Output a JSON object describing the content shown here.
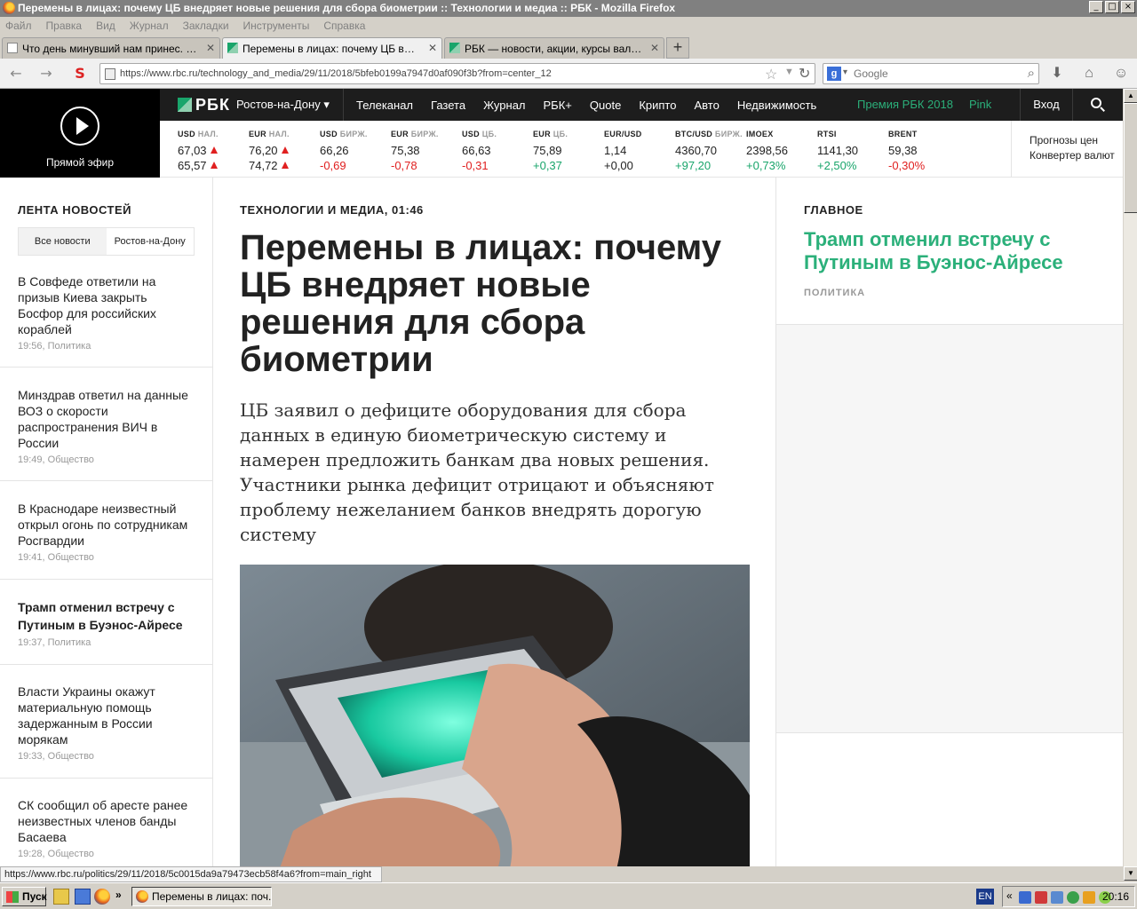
{
  "window": {
    "title": "Перемены в лицах: почему ЦБ внедряет новые решения для сбора биометрии :: Технологии и медиа :: РБК - Mozilla Firefox",
    "controls": [
      "_",
      "□",
      "×"
    ]
  },
  "menu": [
    "Файл",
    "Правка",
    "Вид",
    "Журнал",
    "Закладки",
    "Инструменты",
    "Справка"
  ],
  "tabs": [
    {
      "label": "Что день минувший нам принес. Аргум..."
    },
    {
      "label": "Перемены в лицах: почему ЦБ внедря..."
    },
    {
      "label": "РБК — новости, акции, курсы валют, ..."
    }
  ],
  "nav": {
    "url": "https://www.rbc.ru/technology_and_media/29/11/2018/5bfeb0199a7947d0af090f3b?from=center_12",
    "search_placeholder": "Google"
  },
  "site": {
    "live_label": "Прямой эфир",
    "logo": "РБК",
    "city": "Ростов-на-Дону ▾",
    "nav": [
      "Телеканал",
      "Газета",
      "Журнал",
      "РБК+",
      "Quote",
      "Крипто",
      "Авто",
      "Недвижимость"
    ],
    "premium": "Премия РБК 2018",
    "pink": "Pink",
    "login": "Вход"
  },
  "tickers": [
    {
      "label": "USD",
      "sub": "НАЛ.",
      "v1": "67,03",
      "v2": "65,57",
      "arrows": true
    },
    {
      "label": "EUR",
      "sub": "НАЛ.",
      "v1": "76,20",
      "v2": "74,72",
      "arrows": true
    },
    {
      "label": "USD",
      "sub": "БИРЖ.",
      "v1": "66,26",
      "v2": "-0,69",
      "c2": "down"
    },
    {
      "label": "EUR",
      "sub": "БИРЖ.",
      "v1": "75,38",
      "v2": "-0,78",
      "c2": "down"
    },
    {
      "label": "USD",
      "sub": "ЦБ.",
      "v1": "66,63",
      "v2": "-0,31",
      "c2": "down"
    },
    {
      "label": "EUR",
      "sub": "ЦБ.",
      "v1": "75,89",
      "v2": "+0,37",
      "c2": "up"
    },
    {
      "label": "EUR/USD",
      "sub": "",
      "v1": "1,14",
      "v2": "+0,00",
      "c2": "neutral"
    },
    {
      "label": "BTC/USD",
      "sub": "БИРЖ.",
      "v1": "4360,70",
      "v2": "+97,20",
      "c2": "up"
    },
    {
      "label": "IMOEX",
      "sub": "",
      "v1": "2398,56",
      "v2": "+0,73%",
      "c2": "up"
    },
    {
      "label": "RTSI",
      "sub": "",
      "v1": "1141,30",
      "v2": "+2,50%",
      "c2": "up"
    },
    {
      "label": "BRENT",
      "sub": "",
      "v1": "59,38",
      "v2": "-0,30%",
      "c2": "down"
    }
  ],
  "ticker_links": [
    "Прогнозы цен",
    "Конвертер валют"
  ],
  "feed": {
    "heading": "ЛЕНТА НОВОСТЕЙ",
    "tabs": [
      "Все новости",
      "Ростов-на-Дону"
    ],
    "items": [
      {
        "title": "В Совфеде ответили на призыв Киева закрыть Босфор для российских кораблей",
        "meta": "19:56, Политика"
      },
      {
        "title": "Минздрав ответил на данные ВОЗ о скорости распространения ВИЧ в России",
        "meta": "19:49, Общество"
      },
      {
        "title": "В Краснодаре неизвестный открыл огонь по сотрудникам Росгвардии",
        "meta": "19:41, Общество"
      },
      {
        "title": "Трамп отменил встречу с Путиным в Буэнос-Айресе",
        "meta": "19:37, Политика",
        "bold": true
      },
      {
        "title": "Власти Украины окажут материальную помощь задержанным в России морякам",
        "meta": "19:33, Общество"
      },
      {
        "title": "СК сообщил об аресте ранее неизвестных членов банды Басаева",
        "meta": "19:28, Общество"
      }
    ]
  },
  "article": {
    "category": "ТЕХНОЛОГИИ И МЕДИА, 01:46",
    "title": "Перемены в лицах: почему ЦБ внедряет новые решения для сбора биометрии",
    "lead": "ЦБ заявил о дефиците оборудования для сбора данных в единую биометрическую систему и намерен предложить банкам два новых решения. Участники рынка дефицит отрицают и объясняют проблему нежеланием банков внедрять дорогую систему"
  },
  "main": {
    "heading": "ГЛАВНОЕ",
    "title": "Трамп отменил встречу с Путиным в Буэнос-Айресе",
    "category": "ПОЛИТИКА"
  },
  "status_url": "https://www.rbc.ru/politics/29/11/2018/5c0015da9a79473ecb58f4a6?from=main_right",
  "taskbar": {
    "start": "Пуск",
    "task": "Перемены в лицах: поч...",
    "lang": "EN",
    "clock": "20:16"
  },
  "colors": {
    "accent": "#2bb07a",
    "up": "#19a56b",
    "down": "#e02020",
    "header": "#1d1d1d"
  }
}
